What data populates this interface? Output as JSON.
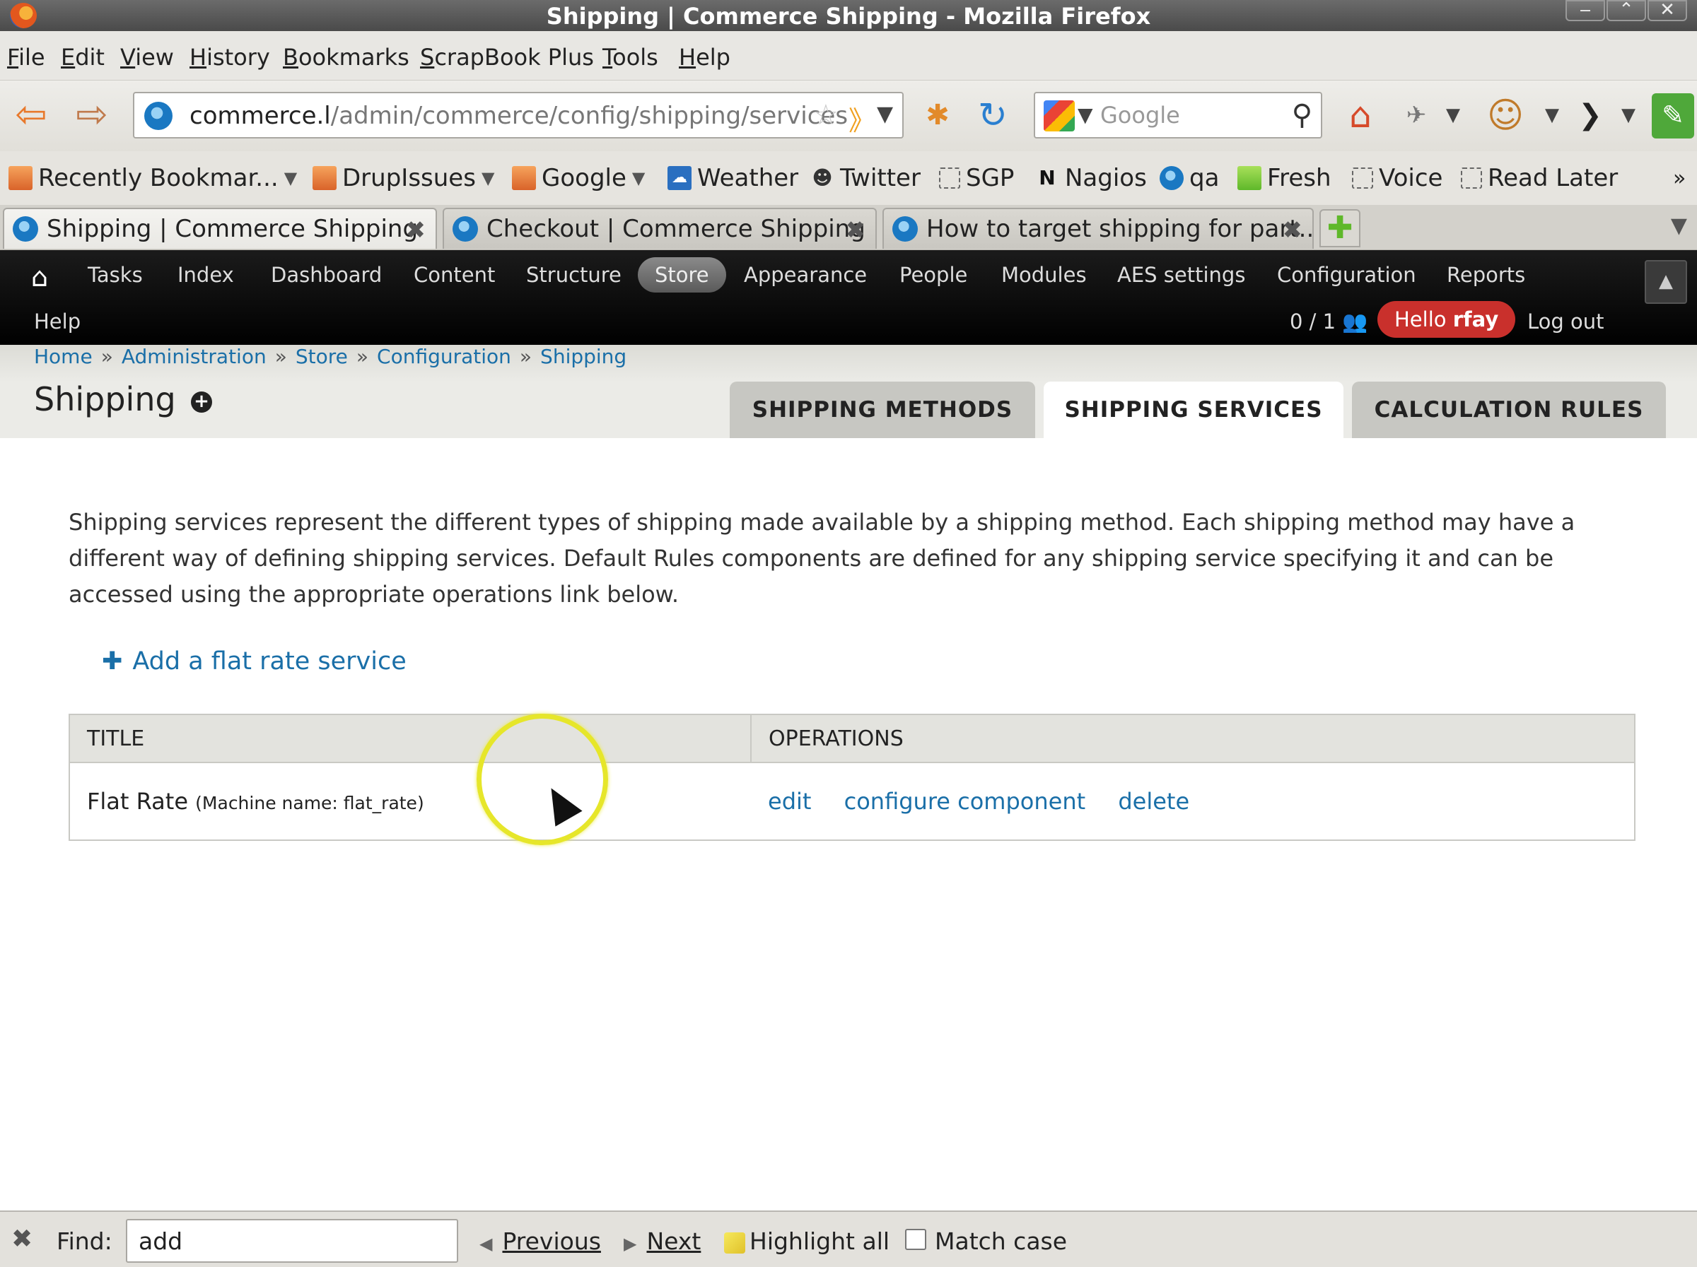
{
  "window": {
    "title": "Shipping | Commerce Shipping - Mozilla Firefox"
  },
  "menubar": [
    "File",
    "Edit",
    "View",
    "History",
    "Bookmarks",
    "ScrapBook Plus",
    "Tools",
    "Help"
  ],
  "navbar": {
    "url_host": "commerce.l",
    "url_path": "/admin/commerce/config/shipping/services",
    "search_placeholder": "Google"
  },
  "bookmarks": [
    "Recently Bookmar...",
    "DrupIssues",
    "Google",
    "Weather",
    "Twitter",
    "SGP",
    "Nagios",
    "qa",
    "Fresh",
    "Voice",
    "Read Later"
  ],
  "tabs": [
    {
      "label": "Shipping | Commerce Shipping",
      "active": true
    },
    {
      "label": "Checkout | Commerce Shipping",
      "active": false
    },
    {
      "label": "How to target shipping for part...",
      "active": false
    }
  ],
  "admin_toolbar": {
    "menu": [
      "Tasks",
      "Index",
      "Dashboard",
      "Content",
      "Structure",
      "Store",
      "Appearance",
      "People",
      "Modules",
      "AES settings",
      "Configuration",
      "Reports"
    ],
    "active": "Store",
    "help": "Help",
    "user_count": "0 / 1",
    "hello_prefix": "Hello ",
    "username": "rfay",
    "logout": "Log out"
  },
  "breadcrumb": [
    "Home",
    "Administration",
    "Store",
    "Configuration",
    "Shipping"
  ],
  "page": {
    "title": "Shipping",
    "tabs": [
      "SHIPPING METHODS",
      "SHIPPING SERVICES",
      "CALCULATION RULES"
    ],
    "active_tab": "SHIPPING SERVICES",
    "description": "Shipping services represent the different types of shipping made available by a shipping method. Each shipping method may have a different way of defining shipping services. Default Rules components are defined for any shipping service specifying it and can be accessed using the appropriate operations link below.",
    "add_link": "Add a flat rate service",
    "table": {
      "headers": [
        "TITLE",
        "OPERATIONS"
      ],
      "rows": [
        {
          "title": "Flat Rate",
          "machine": "(Machine name: flat_rate)",
          "ops": [
            "edit",
            "configure component",
            "delete"
          ]
        }
      ]
    }
  },
  "findbar": {
    "label": "Find:",
    "value": "add",
    "previous": "Previous",
    "next": "Next",
    "highlight": "Highlight all",
    "match_case": "Match case"
  }
}
